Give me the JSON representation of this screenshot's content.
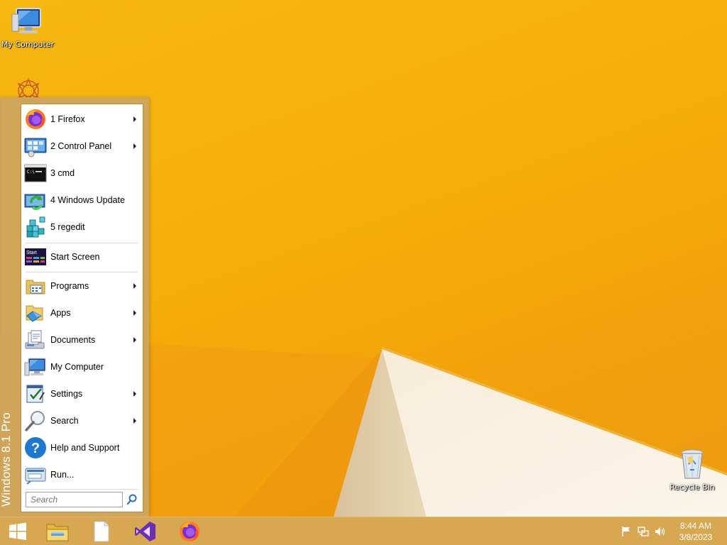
{
  "desktop": {
    "icons": [
      {
        "label": "My Computer",
        "icon": "computer-icon"
      },
      {
        "label": "Recycle Bin",
        "icon": "recycle-bin-icon"
      }
    ]
  },
  "start_menu": {
    "banner": "Windows 8.1 Pro",
    "recent": [
      {
        "label": "1 Firefox",
        "icon": "firefox-icon",
        "has_submenu": true
      },
      {
        "label": "2 Control Panel",
        "icon": "control-panel-icon",
        "has_submenu": true
      },
      {
        "label": "3 cmd",
        "icon": "cmd-icon",
        "has_submenu": false
      },
      {
        "label": "4 Windows Update",
        "icon": "windows-update-icon",
        "has_submenu": false
      },
      {
        "label": "5 regedit",
        "icon": "regedit-icon",
        "has_submenu": false
      }
    ],
    "start_screen": {
      "label": "Start Screen",
      "icon": "start-screen-icon",
      "icon_text": "Start"
    },
    "items": [
      {
        "label": "Programs",
        "icon": "programs-icon",
        "has_submenu": true
      },
      {
        "label": "Apps",
        "icon": "apps-icon",
        "has_submenu": true
      },
      {
        "label": "Documents",
        "icon": "documents-icon",
        "has_submenu": true
      },
      {
        "label": "My Computer",
        "icon": "computer-icon",
        "has_submenu": false
      },
      {
        "label": "Settings",
        "icon": "settings-icon",
        "has_submenu": true
      },
      {
        "label": "Search",
        "icon": "search-icon",
        "has_submenu": true
      },
      {
        "label": "Help and Support",
        "icon": "help-icon",
        "has_submenu": false
      },
      {
        "label": "Run...",
        "icon": "run-icon",
        "has_submenu": false
      }
    ],
    "search": {
      "placeholder": "Search",
      "value": ""
    }
  },
  "taskbar": {
    "pinned": [
      {
        "icon": "windows-start-icon"
      },
      {
        "icon": "file-explorer-icon"
      },
      {
        "icon": "notepad-icon"
      },
      {
        "icon": "visual-studio-icon"
      },
      {
        "icon": "firefox-icon"
      }
    ],
    "tray": [
      {
        "icon": "action-center-flag-icon"
      },
      {
        "icon": "network-icon"
      },
      {
        "icon": "volume-icon"
      }
    ],
    "clock": {
      "time": "8:44 AM",
      "date": "3/8/2023"
    }
  },
  "colors": {
    "wallpaper": "#f5ad0c",
    "taskbar": "#d6a856",
    "start_menu_frame": "#cda55f",
    "panel": "#ffffff"
  }
}
